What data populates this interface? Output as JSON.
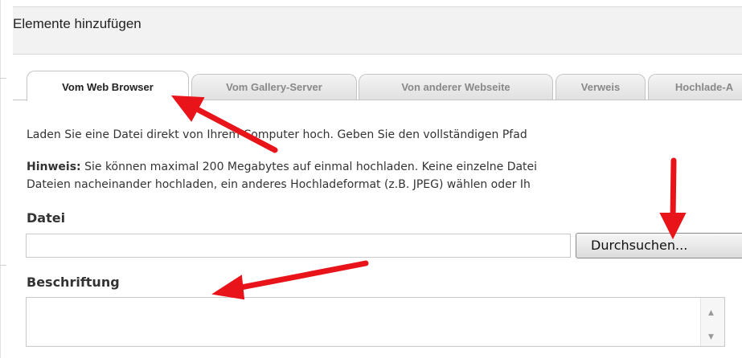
{
  "panel": {
    "title": "Elemente hinzufügen"
  },
  "tabs": [
    {
      "label": "Vom Web Browser",
      "active": true
    },
    {
      "label": "Vom Gallery-Server",
      "active": false
    },
    {
      "label": "Von anderer Webseite",
      "active": false
    },
    {
      "label": "Verweis",
      "active": false
    },
    {
      "label": "Hochlade-A",
      "active": false
    }
  ],
  "content": {
    "intro": "Laden Sie eine Datei direkt von Ihrem Computer hoch. Geben Sie den vollständigen Pfad",
    "note_label": "Hinweis:",
    "note_line1": " Sie können maximal 200 Megabytes auf einmal hochladen. Keine einzelne Datei",
    "note_line2": "Dateien nacheinander hochladen, ein anderes Hochladeformat (z.B. JPEG) wählen oder Ih"
  },
  "file_field": {
    "label": "Datei",
    "value": "",
    "button_label": "Durchsuchen..."
  },
  "caption_field": {
    "label": "Beschriftung",
    "value": ""
  },
  "colors": {
    "annotation_arrow": "#e8141a",
    "active_tab": "#ffffff",
    "inactive_tab": "#e6e6e6"
  },
  "icons": {
    "scroll_up": "▲",
    "scroll_down": "▼"
  }
}
